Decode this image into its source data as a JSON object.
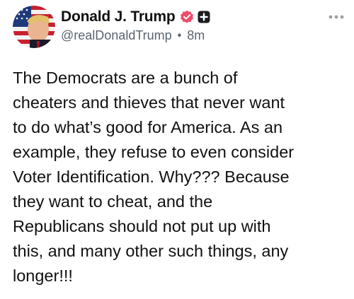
{
  "post": {
    "author": {
      "display_name": "Donald J. Trump",
      "handle": "@realDonaldTrump",
      "verified_badge_icon": "verified-badge-icon",
      "plus_badge_icon": "plus-badge-icon",
      "avatar_icon": "avatar"
    },
    "timestamp": "8m",
    "separator": "•",
    "more_menu_icon": "more-options-icon",
    "text": "The Democrats are a bunch of\ncheaters and thieves that never want\nto do what’s good for America. As an\nexample, they refuse to even consider\nVoter Identification. Why??? Because\nthey want to cheat, and the\nRepublicans should not put up with\nthis, and many other such things, any\nlonger!!!"
  },
  "colors": {
    "text": "#111111",
    "secondary_text": "#5b6470",
    "verified_badge": "#ee4b6a",
    "plus_badge": "#1c1c1e",
    "more_menu": "#9aa0a6"
  }
}
